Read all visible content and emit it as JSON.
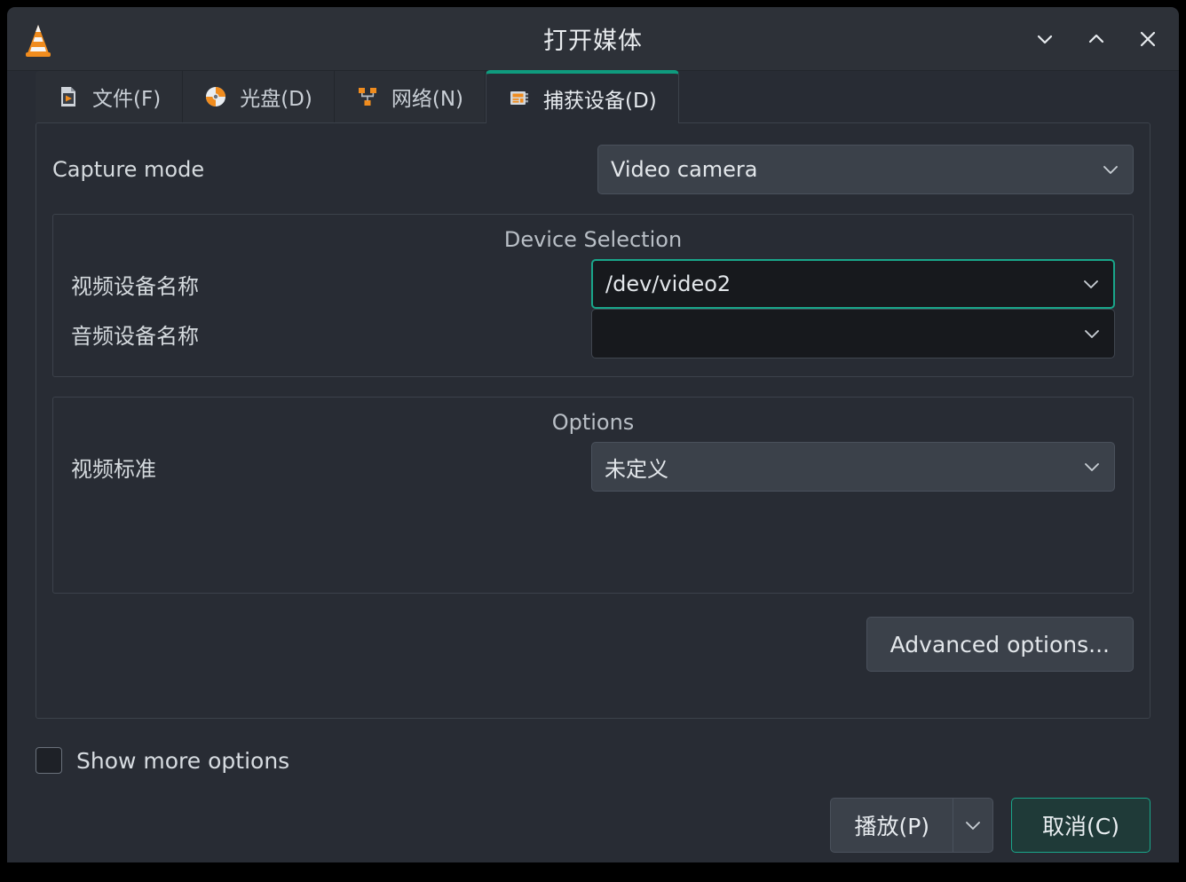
{
  "window": {
    "title": "打开媒体",
    "app_icon": "vlc-cone-icon",
    "controls": {
      "minimize": "chevron-down-icon",
      "maximize": "chevron-up-icon",
      "close": "close-icon"
    }
  },
  "tabs": [
    {
      "label": "文件(F)",
      "icon": "file-icon",
      "active": false
    },
    {
      "label": "光盘(D)",
      "icon": "disc-icon",
      "active": false
    },
    {
      "label": "网络(N)",
      "icon": "network-icon",
      "active": false
    },
    {
      "label": "捕获设备(D)",
      "icon": "capture-card-icon",
      "active": true
    }
  ],
  "capture": {
    "mode_label": "Capture mode",
    "mode_value": "Video camera",
    "device_group": {
      "title": "Device Selection",
      "video_label": "视频设备名称",
      "video_value": "/dev/video2",
      "audio_label": "音频设备名称",
      "audio_value": ""
    },
    "options_group": {
      "title": "Options",
      "standard_label": "视频标准",
      "standard_value": "未定义"
    },
    "advanced_button": "Advanced options..."
  },
  "footer": {
    "show_more_label": "Show more options",
    "show_more_checked": false,
    "play_button": "播放(P)",
    "play_dropdown_icon": "chevron-down-icon",
    "cancel_button": "取消(C)"
  },
  "colors": {
    "accent_teal": "#0f9b7e",
    "focus_teal": "#19a68a",
    "icon_orange": "#f08c1e",
    "window_bg": "#282c34",
    "titlebar_bg": "#2d3138",
    "combo_bg": "#3b414a",
    "combo_dark_bg": "#17191d"
  }
}
